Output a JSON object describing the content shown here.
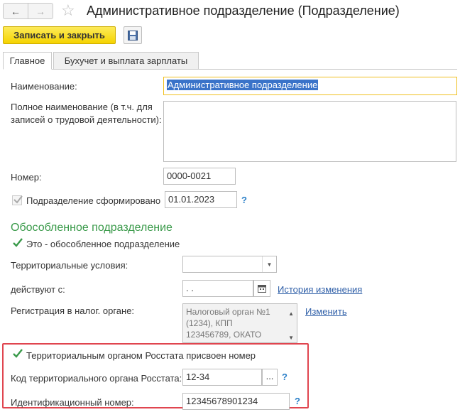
{
  "window": {
    "title": "Административное подразделение (Подразделение)"
  },
  "toolbar": {
    "save_close_label": "Записать и закрыть"
  },
  "tabs": [
    {
      "label": "Главное",
      "active": true
    },
    {
      "label": "Бухучет и выплата зарплаты",
      "active": false
    }
  ],
  "form": {
    "name_label": "Наименование:",
    "name_value": "Административное подразделение",
    "full_name_label_1": "Полное наименование (в т.ч. для",
    "full_name_label_2": "записей о трудовой деятельности):",
    "full_name_value": "",
    "number_label": "Номер:",
    "number_value": "0000-0021",
    "formed_label": "Подразделение сформировано",
    "formed_checked": true,
    "formed_date": "01.01.2023",
    "help_mark": "?"
  },
  "separate_section": {
    "title": "Обособленное подразделение",
    "is_separate_label": "Это - обособленное подразделение",
    "is_separate_checked": true,
    "territorial_label": "Территориальные условия:",
    "territorial_value": "",
    "valid_from_label": "действуют с:",
    "valid_from_value": " .  .",
    "history_link": "История изменения",
    "tax_reg_label": "Регистрация в налог. органе:",
    "tax_reg_lines": [
      "Налоговый орган №1",
      "(1234), КПП",
      "123456789, ОКАТО"
    ],
    "change_link": "Изменить"
  },
  "rosstat": {
    "assigned_label": "Территориальным органом Росстата присвоен номер",
    "assigned_checked": true,
    "code_label": "Код территориального органа Росстата:",
    "code_value": "12-34",
    "code_button": "...",
    "id_label": "Идентификационный номер:",
    "id_value": "12345678901234"
  },
  "colors": {
    "accent_button": "#f5d300",
    "section_title": "#3a9a4a",
    "link": "#2f5fa8",
    "highlight_frame": "#e0454f",
    "checkmark": "#3a9a4a"
  }
}
